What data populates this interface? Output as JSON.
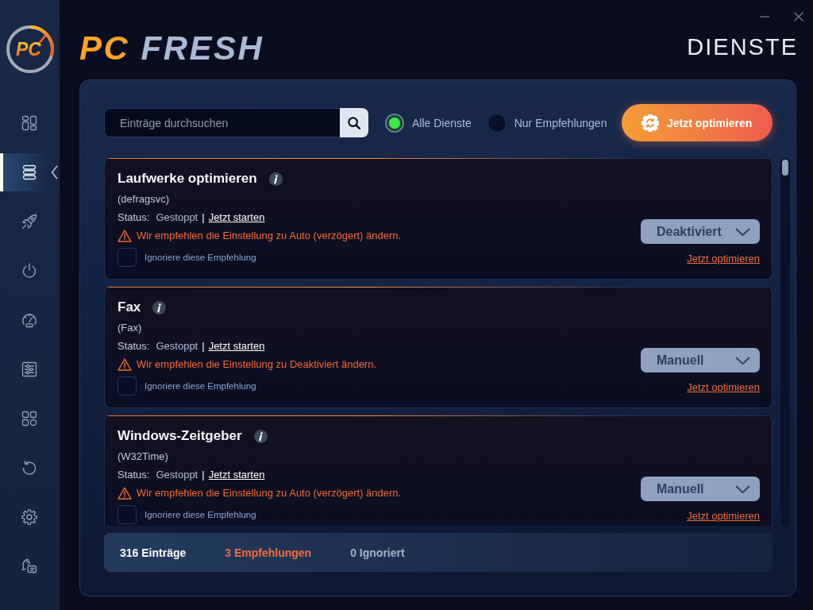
{
  "brand": {
    "badge": "PC",
    "prefix": "PC",
    "name": "FRESH"
  },
  "page_title": "DIENSTE",
  "sidebar": {
    "items": [
      {
        "selected": false
      },
      {
        "selected": true
      },
      {
        "selected": false
      },
      {
        "selected": false
      },
      {
        "selected": false
      },
      {
        "selected": false
      },
      {
        "selected": false
      },
      {
        "selected": false
      },
      {
        "selected": false
      },
      {
        "selected": false
      }
    ]
  },
  "toolbar": {
    "search": {
      "placeholder": "Einträge durchsuchen"
    },
    "filters": [
      {
        "label": "Alle Dienste",
        "selected": true
      },
      {
        "label": "Nur Empfehlungen",
        "selected": false
      }
    ],
    "optimize_button": {
      "label": "Jetzt optimieren"
    }
  },
  "services": [
    {
      "title": "Laufwerke optimieren",
      "service_name": "(defragsvc)",
      "status_label": "Status:",
      "status": "Gestoppt",
      "separator": "|",
      "start_link": "Jetzt starten",
      "recommendation": "Wir empfehlen die Einstellung zu Auto (verzögert) ändern.",
      "ignore_label": "Ignoriere diese Empfehlung",
      "ignored": false,
      "startup_type": "Deaktiviert",
      "optimize_link": "Jetzt optimieren"
    },
    {
      "title": "Fax",
      "service_name": "(Fax)",
      "status_label": "Status:",
      "status": "Gestoppt",
      "separator": "|",
      "start_link": "Jetzt starten",
      "recommendation": "Wir empfehlen die Einstellung zu Deaktiviert ändern.",
      "ignore_label": "Ignoriere diese Empfehlung",
      "ignored": false,
      "startup_type": "Manuell",
      "optimize_link": "Jetzt optimieren"
    },
    {
      "title": "Windows-Zeitgeber",
      "service_name": "(W32Time)",
      "status_label": "Status:",
      "status": "Gestoppt",
      "separator": "|",
      "start_link": "Jetzt starten",
      "recommendation": "Wir empfehlen die Einstellung zu Auto (verzögert) ändern.",
      "ignore_label": "Ignoriere diese Empfehlung",
      "ignored": false,
      "startup_type": "Manuell",
      "optimize_link": "Jetzt optimieren"
    }
  ],
  "summary": [
    {
      "kind": "total",
      "label": "316 Einträge"
    },
    {
      "kind": "recommendations",
      "label": "3 Empfehlungen"
    },
    {
      "kind": "ignored",
      "label": "0 Ignoriert"
    }
  ]
}
